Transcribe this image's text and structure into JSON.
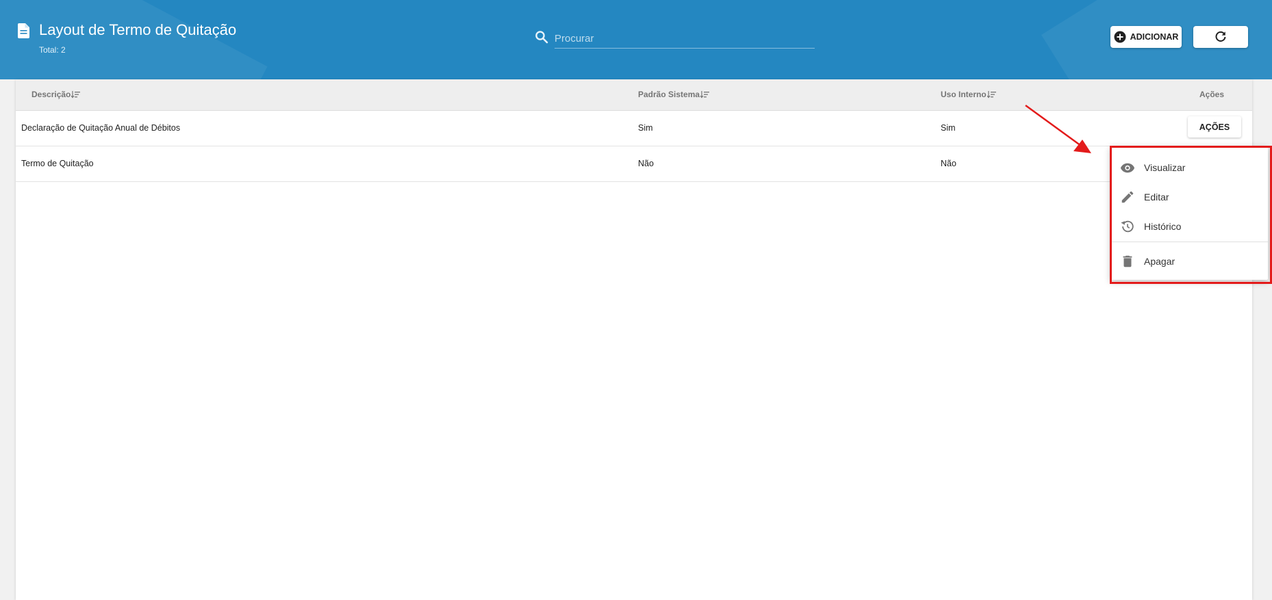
{
  "header": {
    "title": "Layout de Termo de Quitação",
    "total": "Total: 2",
    "search_placeholder": "Procurar",
    "add_label": "ADICIONAR"
  },
  "table": {
    "columns": [
      "Descrição",
      "Padrão Sistema",
      "Uso Interno",
      "Ações"
    ],
    "rows": [
      {
        "descricao": "Declaração de Quitação Anual de Débitos",
        "padrao": "Sim",
        "uso": "Sim",
        "action_label": "AÇÕES"
      },
      {
        "descricao": "Termo de Quitação",
        "padrao": "Não",
        "uso": "Não"
      }
    ]
  },
  "menu": {
    "items": [
      "Visualizar",
      "Editar",
      "Histórico",
      "Apagar"
    ]
  },
  "annotation_color": "#e31b1b",
  "colors": {
    "header_bg": "#2487c1",
    "table_header_bg": "#eeeeee"
  }
}
